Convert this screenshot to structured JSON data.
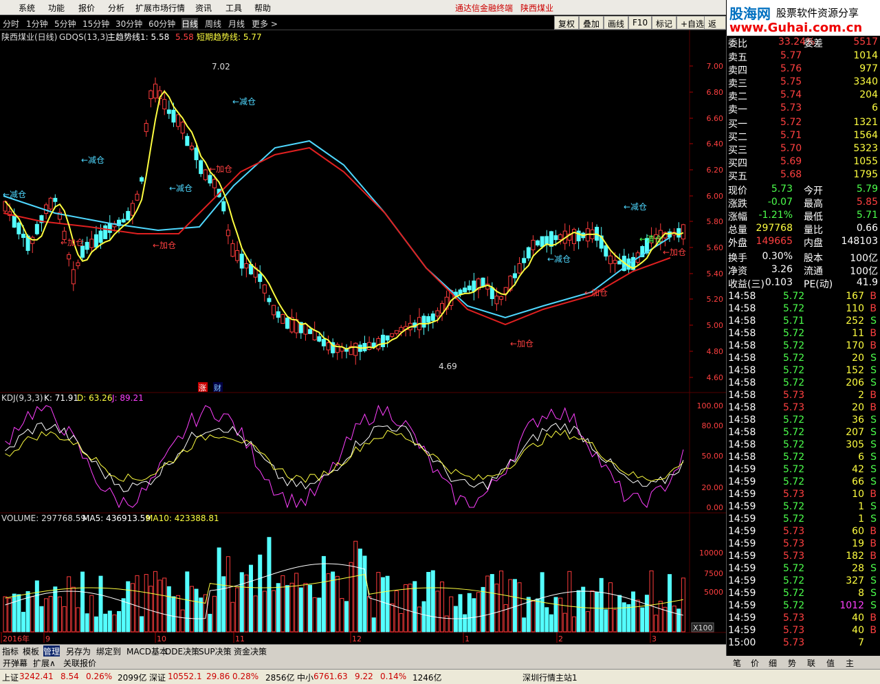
{
  "menu": [
    "系统",
    "功能",
    "报价",
    "分析",
    "扩展市场行情",
    "资讯",
    "工具",
    "帮助"
  ],
  "app_title": "通达信金融终端",
  "stock_title": "陕西煤业",
  "periods": [
    "分时",
    "1分钟",
    "5分钟",
    "15分钟",
    "30分钟",
    "60分钟",
    "日线",
    "周线",
    "月线",
    "更多 >"
  ],
  "right_buttons": [
    "复权",
    "叠加",
    "画线",
    "F10",
    "标记",
    "+自选",
    "返回"
  ],
  "logo": {
    "main": "股海网",
    "tag": "股票软件资源分享",
    "url": "www.Guhai.com.cn"
  },
  "main_header": {
    "name": "陕西煤业(日线)",
    "ind": "GDQS(13,3)",
    "l1": "主趋势线1: 5.58",
    "l1v": "5.58",
    "l2": "短期趋势线: 5.77"
  },
  "kdj_header": {
    "name": "KDJ(9,3,3)",
    "k": "K: 71.91",
    "d": "D: 63.26",
    "j": "J: 89.21"
  },
  "vol_header": {
    "name": "VOLUME: 297768.59",
    "ma5": "MA5: 436913.59",
    "ma10": "MA10: 423388.81"
  },
  "annotations": {
    "hi": "7.02",
    "lo": "4.69",
    "jian": "←减仓",
    "jia": "←加仓",
    "qing": "←清仓",
    "zhang": "涨",
    "cai": "财",
    "x100": "X100"
  },
  "price_axis": [
    "7.00",
    "6.80",
    "6.60",
    "6.40",
    "6.20",
    "6.00",
    "5.80",
    "5.60",
    "5.40",
    "5.20",
    "5.00",
    "4.80",
    "4.60"
  ],
  "kdj_axis": [
    "100.00",
    "80.00",
    "50.00",
    "20.00",
    "0.00"
  ],
  "vol_axis": [
    "10000",
    "7500",
    "5000"
  ],
  "date_axis": [
    "2016年",
    "9",
    "10",
    "11",
    "12",
    "1",
    "2",
    "3"
  ],
  "quote": {
    "top": {
      "label": "委比",
      "pct": "33.24%",
      "label2": "委差",
      "val": "5517"
    },
    "sell": [
      {
        "l": "卖五",
        "p": "5.77",
        "v": "1014"
      },
      {
        "l": "卖四",
        "p": "5.76",
        "v": "977"
      },
      {
        "l": "卖三",
        "p": "5.75",
        "v": "3340"
      },
      {
        "l": "卖二",
        "p": "5.74",
        "v": "204"
      },
      {
        "l": "卖一",
        "p": "5.73",
        "v": "6"
      }
    ],
    "buy": [
      {
        "l": "买一",
        "p": "5.72",
        "v": "1321"
      },
      {
        "l": "买二",
        "p": "5.71",
        "v": "1564"
      },
      {
        "l": "买三",
        "p": "5.70",
        "v": "5323"
      },
      {
        "l": "买四",
        "p": "5.69",
        "v": "1055"
      },
      {
        "l": "买五",
        "p": "5.68",
        "v": "1795"
      }
    ],
    "info": [
      {
        "a": "现价",
        "av": "5.73",
        "b": "今开",
        "bv": "5.79"
      },
      {
        "a": "涨跌",
        "av": "-0.07",
        "b": "最高",
        "bv": "5.85"
      },
      {
        "a": "涨幅",
        "av": "-1.21%",
        "b": "最低",
        "bv": "5.71"
      },
      {
        "a": "总量",
        "av": "297768",
        "b": "量比",
        "bv": "0.66"
      },
      {
        "a": "外盘",
        "av": "149665",
        "b": "内盘",
        "bv": "148103"
      },
      {
        "a": "换手",
        "av": "0.30%",
        "b": "股本",
        "bv": "100亿"
      },
      {
        "a": "净资",
        "av": "3.26",
        "b": "流通",
        "bv": "100亿"
      },
      {
        "a": "收益(三)",
        "av": "0.103",
        "b": "PE(动)",
        "bv": "41.9"
      }
    ]
  },
  "ticks": [
    [
      "14:58",
      "5.72",
      "167",
      "B"
    ],
    [
      "14:58",
      "5.72",
      "110",
      "B"
    ],
    [
      "14:58",
      "5.71",
      "252",
      "S"
    ],
    [
      "14:58",
      "5.72",
      "11",
      "B"
    ],
    [
      "14:58",
      "5.72",
      "170",
      "B"
    ],
    [
      "14:58",
      "5.72",
      "20",
      "S"
    ],
    [
      "14:58",
      "5.72",
      "152",
      "S"
    ],
    [
      "14:58",
      "5.72",
      "206",
      "S"
    ],
    [
      "14:58",
      "5.73",
      "2",
      "B"
    ],
    [
      "14:58",
      "5.73",
      "20",
      "B"
    ],
    [
      "14:58",
      "5.72",
      "36",
      "S"
    ],
    [
      "14:58",
      "5.72",
      "207",
      "S"
    ],
    [
      "14:58",
      "5.72",
      "305",
      "S"
    ],
    [
      "14:58",
      "5.72",
      "6",
      "S"
    ],
    [
      "14:59",
      "5.72",
      "42",
      "S"
    ],
    [
      "14:59",
      "5.72",
      "66",
      "S"
    ],
    [
      "14:59",
      "5.73",
      "10",
      "B"
    ],
    [
      "14:59",
      "5.72",
      "1",
      "S"
    ],
    [
      "14:59",
      "5.72",
      "1",
      "S"
    ],
    [
      "14:59",
      "5.73",
      "60",
      "B"
    ],
    [
      "14:59",
      "5.73",
      "19",
      "B"
    ],
    [
      "14:59",
      "5.73",
      "182",
      "B"
    ],
    [
      "14:59",
      "5.72",
      "28",
      "S"
    ],
    [
      "14:59",
      "5.72",
      "327",
      "S"
    ],
    [
      "14:59",
      "5.72",
      "8",
      "S"
    ],
    [
      "14:59",
      "5.72",
      "1012",
      "S"
    ],
    [
      "14:59",
      "5.73",
      "40",
      "B"
    ],
    [
      "14:59",
      "5.73",
      "40",
      "B"
    ],
    [
      "15:00",
      "5.73",
      "7",
      ""
    ]
  ],
  "bottom_tabs": [
    "指标",
    "模板",
    "管理",
    "另存为",
    "绑定到",
    "MACD基本",
    "DDE决策",
    "SUP决策",
    "资金决策"
  ],
  "bottom_tabs2": [
    "开弹幕",
    "扩展∧",
    "关联报价"
  ],
  "right_tabs": [
    "笔",
    "价",
    "细",
    "势",
    "联",
    "值",
    "主"
  ],
  "status": {
    "sh": "上证",
    "shv": "3242.41",
    "shc": "8.54",
    "shp": "0.26%",
    "sha": "2099亿",
    "sz": "深证",
    "szv": "10552.1",
    "szc": "29.86",
    "szp": "0.28%",
    "sza": "2856亿",
    "zx": "中小",
    "zxv": "6761.63",
    "zxc": "9.22",
    "zxp": "0.14%",
    "zxa": "1246亿",
    "srv": "深圳行情主站1"
  }
}
